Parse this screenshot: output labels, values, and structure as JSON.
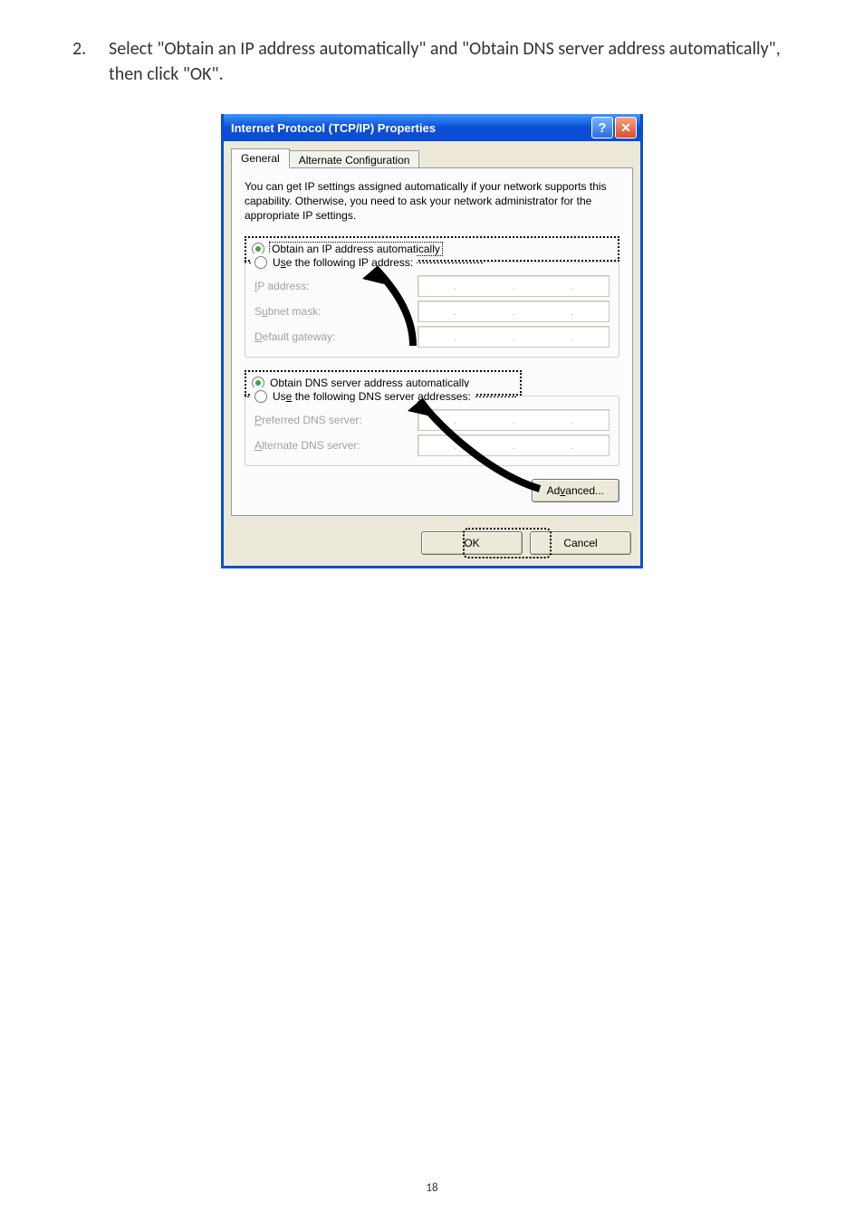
{
  "instruction": {
    "number": "2.",
    "text": "Select \"Obtain an IP address automatically\" and \"Obtain DNS server address automatically\", then click \"OK\"."
  },
  "dialog": {
    "title": "Internet Protocol (TCP/IP) Properties",
    "help_glyph": "?",
    "close_glyph": "✕",
    "tabs": {
      "general": "General",
      "alternate": "Alternate Configuration"
    },
    "description": "You can get IP settings assigned automatically if your network supports this capability. Otherwise, you need to ask your network administrator for the appropriate IP settings.",
    "radios": {
      "obtain_ip_pre": "O",
      "obtain_ip_rest": "btain an IP address automatically",
      "use_ip_pre": "U",
      "use_ip_mid": "s",
      "use_ip_rest": "e the following IP address:",
      "obtain_dns_pre": "O",
      "obtain_dns_mid": "b",
      "obtain_dns_rest": "tain DNS server address automatically",
      "use_dns_pre": "Us",
      "use_dns_mid": "e",
      "use_dns_rest": " the following DNS server addresses:"
    },
    "labels": {
      "ip_pre": "I",
      "ip_rest": "P address:",
      "subnet_pre": "S",
      "subnet_mid": "u",
      "subnet_rest": "bnet mask:",
      "gateway_pre": "D",
      "gateway_rest": "efault gateway:",
      "pref_pre": "P",
      "pref_rest": "referred DNS server:",
      "alt_pre": "A",
      "alt_rest": "lternate DNS server:"
    },
    "buttons": {
      "advanced_pre": "Ad",
      "advanced_mid": "v",
      "advanced_rest": "anced...",
      "ok": "OK",
      "cancel": "Cancel"
    }
  },
  "page_number": "18"
}
